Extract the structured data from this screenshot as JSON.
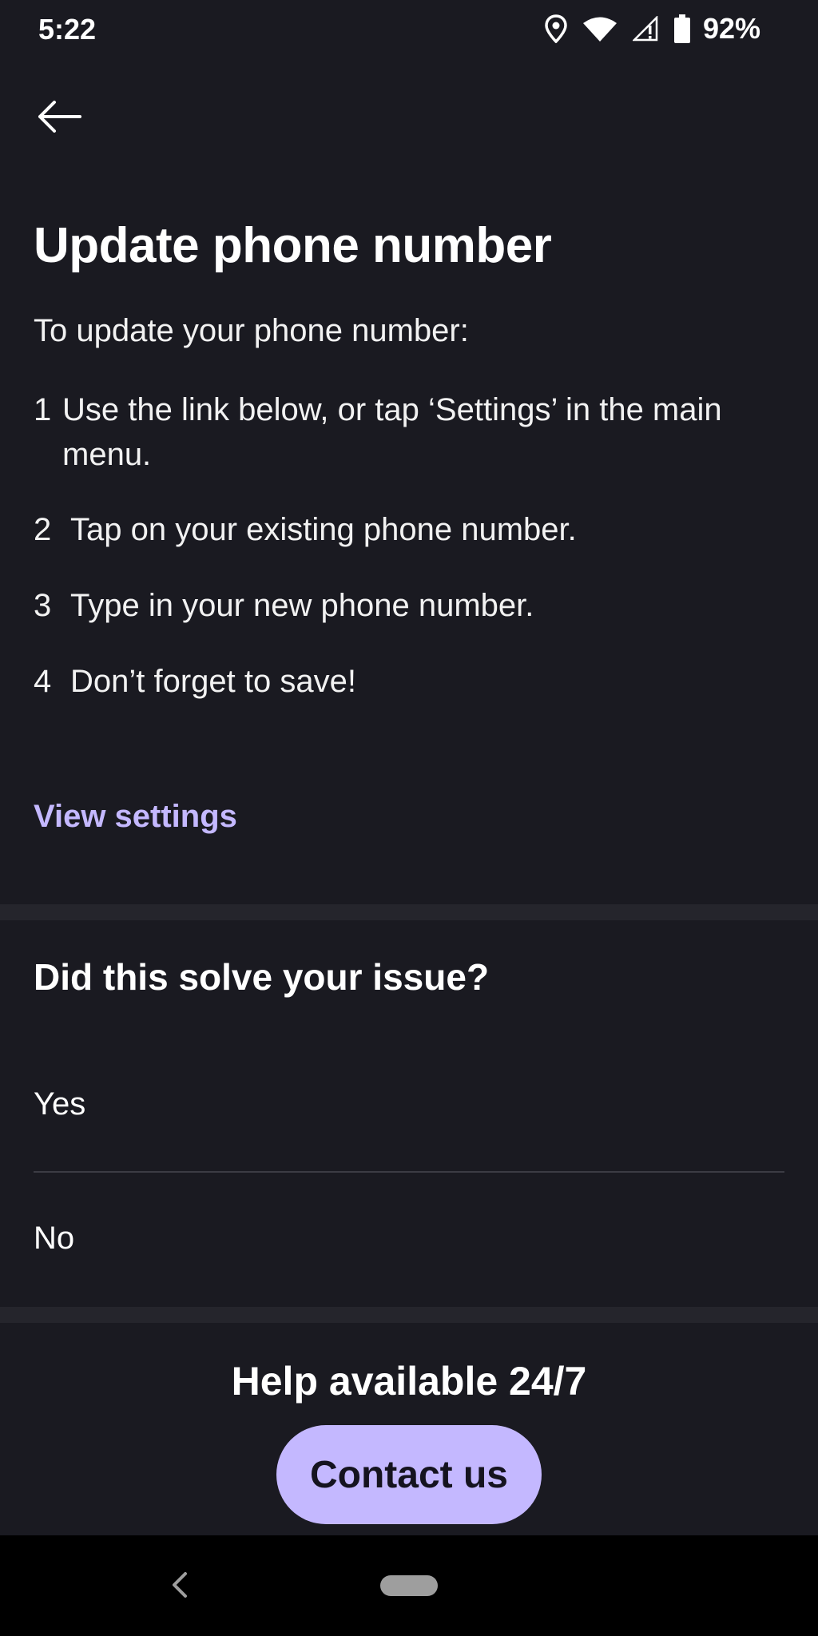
{
  "status_bar": {
    "time": "5:22",
    "battery_percent": "92%",
    "icons": [
      "location-icon",
      "wifi-icon",
      "signal-icon",
      "battery-icon"
    ]
  },
  "header": {
    "back_icon": "arrow-left-icon"
  },
  "main": {
    "title": "Update phone number",
    "intro": "To update your phone number:",
    "steps": [
      {
        "number": "1",
        "text": "Use the link below, or tap ‘Settings’ in the main menu."
      },
      {
        "number": "2",
        "text": "Tap on your existing phone number."
      },
      {
        "number": "3",
        "text": "Type in your new phone number."
      },
      {
        "number": "4",
        "text": "Don’t forget to save!"
      }
    ],
    "link_label": "View settings"
  },
  "feedback": {
    "title": "Did this solve your issue?",
    "options": [
      "Yes",
      "No"
    ]
  },
  "help": {
    "title": "Help available 24/7",
    "button_label": "Contact us"
  },
  "colors": {
    "background": "#1a1a21",
    "divider": "#25252c",
    "accent": "#c4b8ff",
    "button_text": "#15131f",
    "nav_bar": "#000000"
  }
}
